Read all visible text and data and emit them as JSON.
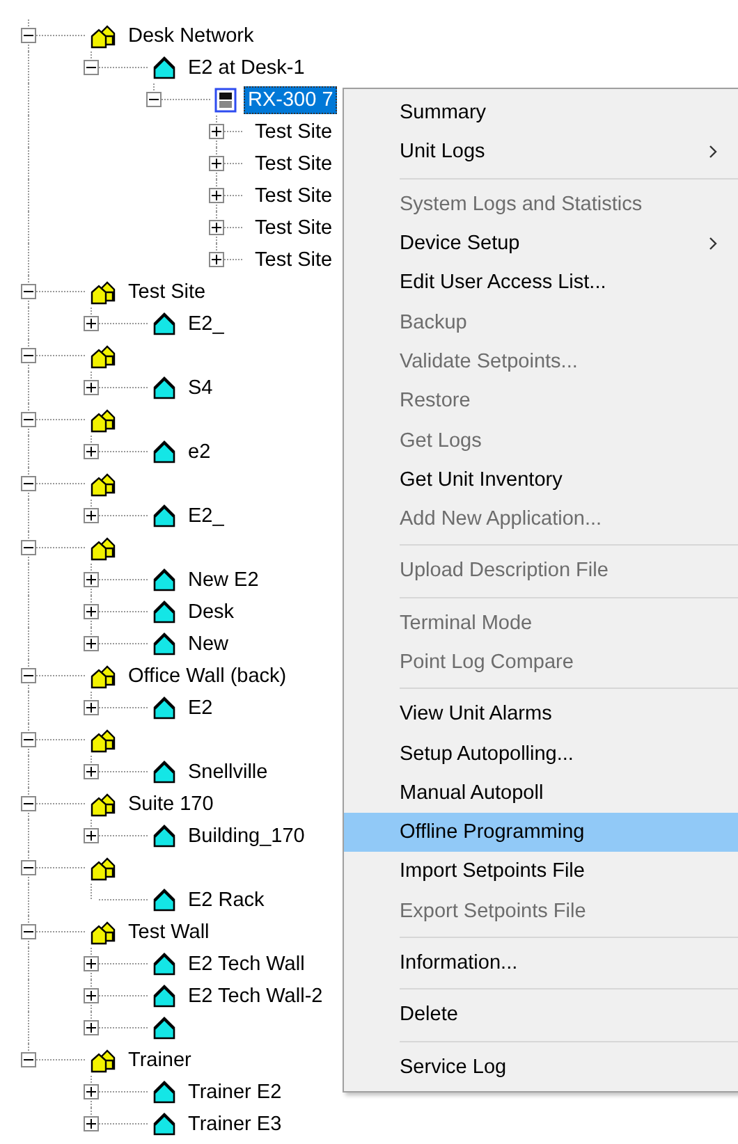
{
  "tree": [
    {
      "kind": "site",
      "label": "Desk Network",
      "expanded": true,
      "selected": false,
      "children": [
        {
          "kind": "unit",
          "label": "E2 at Desk-1",
          "expanded": true,
          "selected": false,
          "children": [
            {
              "kind": "controller",
              "label": "RX-300 7",
              "expanded": true,
              "selected": true,
              "children": [
                {
                  "kind": "board",
                  "label": "Test Site",
                  "expanded": false,
                  "selected": false
                },
                {
                  "kind": "board",
                  "label": "Test Site",
                  "expanded": false,
                  "selected": false
                },
                {
                  "kind": "board",
                  "label": "Test Site",
                  "expanded": false,
                  "selected": false
                },
                {
                  "kind": "board",
                  "label": "Test Site",
                  "expanded": false,
                  "selected": false
                },
                {
                  "kind": "board",
                  "label": "Test Site",
                  "expanded": false,
                  "selected": false
                }
              ]
            }
          ]
        }
      ]
    },
    {
      "kind": "site",
      "label": "Test Site",
      "expanded": true,
      "selected": false,
      "children": [
        {
          "kind": "unit",
          "label": "E2_",
          "expanded": false,
          "selected": false
        }
      ]
    },
    {
      "kind": "site",
      "expanded": true,
      "selected": false,
      "children": [
        {
          "kind": "unit",
          "label": "S4",
          "expanded": false,
          "selected": false
        }
      ]
    },
    {
      "kind": "site",
      "expanded": true,
      "selected": false,
      "children": [
        {
          "kind": "unit",
          "label": "e2",
          "expanded": false,
          "selected": false
        }
      ]
    },
    {
      "kind": "site",
      "expanded": true,
      "selected": false,
      "children": [
        {
          "kind": "unit",
          "label": "E2_",
          "expanded": false,
          "selected": false
        }
      ]
    },
    {
      "kind": "site",
      "expanded": true,
      "selected": false,
      "children": [
        {
          "kind": "unit",
          "label": "New E2",
          "expanded": false,
          "selected": false
        },
        {
          "kind": "unit",
          "label": "Desk",
          "expanded": false,
          "selected": false
        },
        {
          "kind": "unit",
          "label": "New",
          "expanded": false,
          "selected": false
        }
      ]
    },
    {
      "kind": "site",
      "label": "Office Wall (back)",
      "expanded": true,
      "selected": false,
      "children": [
        {
          "kind": "unit",
          "label": "E2",
          "expanded": false,
          "selected": false
        }
      ]
    },
    {
      "kind": "site",
      "expanded": true,
      "selected": false,
      "children": [
        {
          "kind": "unit",
          "label": "Snellville",
          "expanded": false,
          "selected": false
        }
      ]
    },
    {
      "kind": "site",
      "label": "Suite 170",
      "expanded": true,
      "selected": false,
      "children": [
        {
          "kind": "unit",
          "label": "Building_170",
          "expanded": false,
          "selected": false
        }
      ]
    },
    {
      "kind": "site",
      "expanded": true,
      "selected": false,
      "children": [
        {
          "kind": "unit",
          "label": "E2 Rack",
          "selected": false
        }
      ]
    },
    {
      "kind": "site",
      "label": "Test Wall",
      "expanded": true,
      "selected": false,
      "children": [
        {
          "kind": "unit",
          "label": "E2 Tech Wall",
          "expanded": false,
          "selected": false
        },
        {
          "kind": "unit",
          "label": "E2 Tech Wall-2",
          "expanded": false,
          "selected": false
        },
        {
          "kind": "unit",
          "expanded": false,
          "selected": false
        }
      ]
    },
    {
      "kind": "site",
      "label": "Trainer",
      "expanded": true,
      "selected": false,
      "children": [
        {
          "kind": "unit",
          "label": "Trainer E2",
          "expanded": false,
          "selected": false
        },
        {
          "kind": "unit",
          "label": "Trainer E3",
          "expanded": false,
          "selected": false
        }
      ]
    }
  ],
  "context_menu": {
    "groups": [
      [
        {
          "label": "Summary",
          "disabled": false,
          "submenu": false,
          "selected": false
        },
        {
          "label": "Unit Logs",
          "disabled": false,
          "submenu": true,
          "selected": false
        }
      ],
      [
        {
          "label": "System Logs and Statistics",
          "disabled": true,
          "submenu": false,
          "selected": false
        },
        {
          "label": "Device Setup",
          "disabled": false,
          "submenu": true,
          "selected": false
        },
        {
          "label": "Edit User Access List...",
          "disabled": false,
          "submenu": false,
          "selected": false
        },
        {
          "label": "Backup",
          "disabled": true,
          "submenu": false,
          "selected": false
        },
        {
          "label": "Validate Setpoints...",
          "disabled": true,
          "submenu": false,
          "selected": false
        },
        {
          "label": "Restore",
          "disabled": true,
          "submenu": false,
          "selected": false
        },
        {
          "label": "Get Logs",
          "disabled": true,
          "submenu": false,
          "selected": false
        },
        {
          "label": "Get Unit Inventory",
          "disabled": false,
          "submenu": false,
          "selected": false
        },
        {
          "label": "Add New Application...",
          "disabled": true,
          "submenu": false,
          "selected": false
        }
      ],
      [
        {
          "label": "Upload Description File",
          "disabled": true,
          "submenu": false,
          "selected": false
        }
      ],
      [
        {
          "label": "Terminal Mode",
          "disabled": true,
          "submenu": false,
          "selected": false
        },
        {
          "label": "Point Log Compare",
          "disabled": true,
          "submenu": false,
          "selected": false
        }
      ],
      [
        {
          "label": "View Unit Alarms",
          "disabled": false,
          "submenu": false,
          "selected": false
        },
        {
          "label": "Setup Autopolling...",
          "disabled": false,
          "submenu": false,
          "selected": false
        },
        {
          "label": "Manual Autopoll",
          "disabled": false,
          "submenu": false,
          "selected": false
        },
        {
          "label": "Offline Programming",
          "disabled": false,
          "submenu": false,
          "selected": true
        },
        {
          "label": "Import Setpoints File",
          "disabled": false,
          "submenu": false,
          "selected": false
        },
        {
          "label": "Export Setpoints File",
          "disabled": true,
          "submenu": false,
          "selected": false
        }
      ],
      [
        {
          "label": "Information...",
          "disabled": false,
          "submenu": false,
          "selected": false
        }
      ],
      [
        {
          "label": "Delete",
          "disabled": false,
          "submenu": false,
          "selected": false
        }
      ],
      [
        {
          "label": "Service Log",
          "disabled": false,
          "submenu": false,
          "selected": false
        }
      ]
    ]
  }
}
